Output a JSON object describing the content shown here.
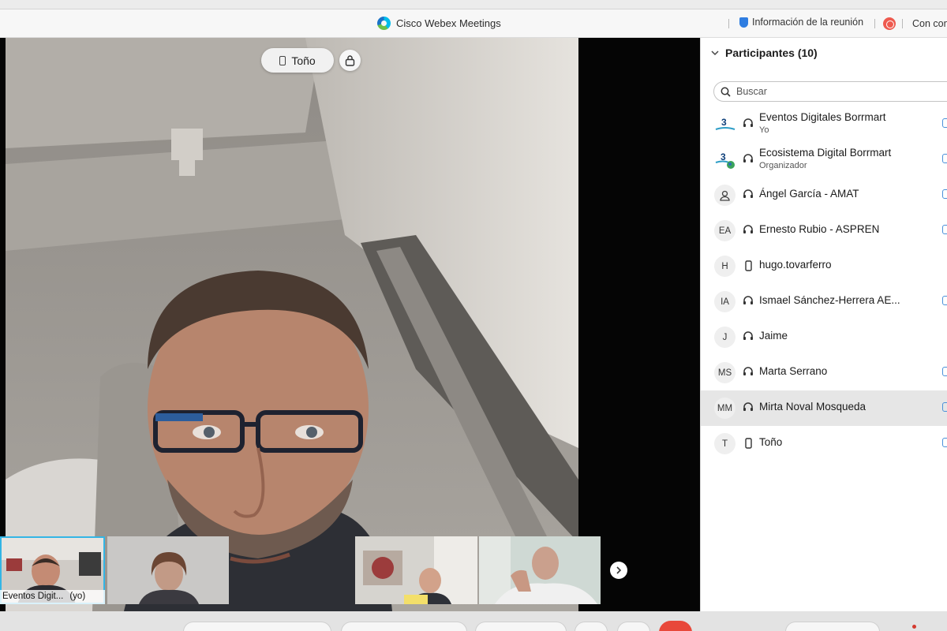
{
  "titlebar": {
    "app_title": "Cisco Webex Meetings",
    "meeting_info_label": "Información de la reunión",
    "right_truncated": "Con con"
  },
  "stage": {
    "active_speaker": "Toño",
    "filmstrip": [
      {
        "name": "Eventos Digit...",
        "suffix": "(yo)",
        "selected": true
      },
      {
        "name": "",
        "suffix": "",
        "selected": false
      },
      {
        "name": "",
        "suffix": "",
        "selected": false
      },
      {
        "name": "",
        "suffix": "",
        "selected": false
      }
    ]
  },
  "participants": {
    "header": "Participantes (10)",
    "search_placeholder": "Buscar",
    "list": [
      {
        "initials": "3",
        "name": "Eventos Digitales Borrmart",
        "role": "Yo",
        "device": "audio",
        "highlight": false
      },
      {
        "initials": "3",
        "name": "Ecosistema Digital Borrmart",
        "role": "Organizador",
        "device": "audio",
        "highlight": false
      },
      {
        "initials": "",
        "name": "Ángel García - AMAT",
        "role": "",
        "device": "audio",
        "highlight": false
      },
      {
        "initials": "EA",
        "name": "Ernesto Rubio - ASPREN",
        "role": "",
        "device": "audio",
        "highlight": false
      },
      {
        "initials": "H",
        "name": "hugo.tovarferro",
        "role": "",
        "device": "phone",
        "highlight": false
      },
      {
        "initials": "IA",
        "name": "Ismael Sánchez-Herrera AE...",
        "role": "",
        "device": "audio",
        "highlight": false
      },
      {
        "initials": "J",
        "name": "Jaime",
        "role": "",
        "device": "audio",
        "highlight": false
      },
      {
        "initials": "MS",
        "name": "Marta Serrano",
        "role": "",
        "device": "audio",
        "highlight": false
      },
      {
        "initials": "MM",
        "name": "Mirta Noval Mosqueda",
        "role": "",
        "device": "audio",
        "highlight": true
      },
      {
        "initials": "T",
        "name": "Toño",
        "role": "",
        "device": "phone",
        "highlight": false
      }
    ]
  },
  "colors": {
    "accent": "#00bceb",
    "end_call": "#e8483a",
    "highlight_row": "#e6e6e6"
  }
}
